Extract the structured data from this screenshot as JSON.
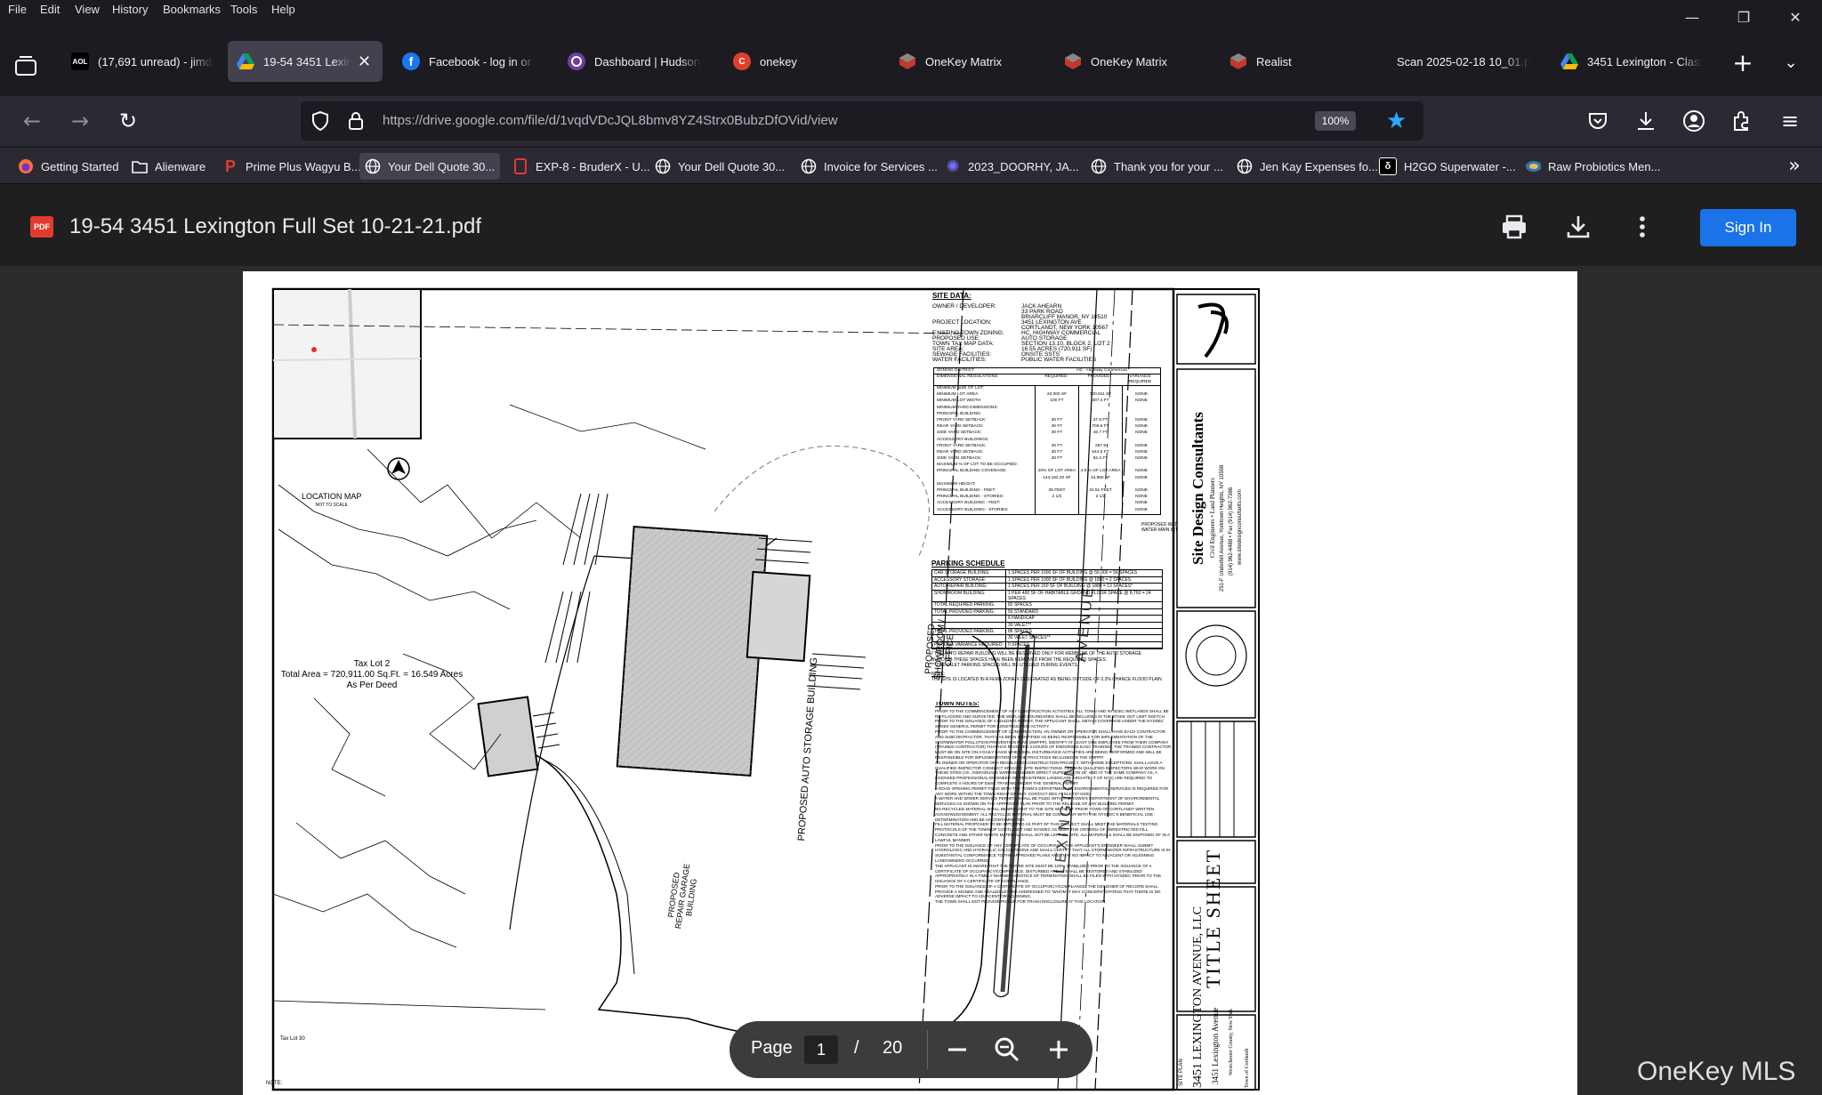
{
  "menu": [
    "File",
    "Edit",
    "View",
    "History",
    "Bookmarks",
    "Tools",
    "Help"
  ],
  "tabs": [
    {
      "title": "(17,691 unread) - jimdi",
      "icon": "aol-icon",
      "active": false
    },
    {
      "title": "19-54 3451 Lexington",
      "icon": "google-drive-icon",
      "active": true
    },
    {
      "title": "Facebook - log in or sig",
      "icon": "facebook-icon",
      "active": false
    },
    {
      "title": "Dashboard | Hudson G",
      "icon": "dashboard-icon",
      "active": false
    },
    {
      "title": "onekey",
      "icon": "onekey-icon",
      "active": false
    },
    {
      "title": "OneKey Matrix",
      "icon": "matrix-icon",
      "active": false
    },
    {
      "title": "OneKey Matrix",
      "icon": "matrix-icon",
      "active": false
    },
    {
      "title": "Realist",
      "icon": "realist-icon",
      "active": false
    },
    {
      "title": "Scan 2025-02-18 10_01.pdf",
      "icon": "",
      "active": false
    },
    {
      "title": "3451 Lexington - Classi",
      "icon": "google-drive-icon",
      "active": false
    }
  ],
  "url": "https://drive.google.com/file/d/1vqdVDcJQL8bmv8YZ4Strx0BubzDfOVid/view",
  "zoom": "100%",
  "bookmarks": [
    {
      "label": "Getting Started",
      "icon": "firefox-icon"
    },
    {
      "label": "Alienware",
      "icon": "folder-icon"
    },
    {
      "label": "Prime Plus Wagyu B...",
      "icon": "prime-icon"
    },
    {
      "label": "Your Dell Quote 30...",
      "icon": "globe-icon"
    },
    {
      "label": "EXP-8 - BruderX - U...",
      "icon": "exp-icon"
    },
    {
      "label": "Your Dell Quote 30...",
      "icon": "globe-icon"
    },
    {
      "label": "Invoice for Services ...",
      "icon": "globe-icon"
    },
    {
      "label": "2023_DOORHY, JA...",
      "icon": "gear-icon"
    },
    {
      "label": "Thank you for your ...",
      "icon": "globe-icon"
    },
    {
      "label": "Jen Kay Expenses fo...",
      "icon": "globe-icon"
    },
    {
      "label": "H2GO Superwater -...",
      "icon": "h2go-icon"
    },
    {
      "label": "Raw Probiotics Men...",
      "icon": "raw-icon"
    }
  ],
  "document": {
    "title": "19-54 3451 Lexington Full Set 10-21-21.pdf",
    "sign_in": "Sign In",
    "pdf_badge": "PDF"
  },
  "pager": {
    "label": "Page",
    "current": "1",
    "separator": "/",
    "total": "20"
  },
  "watermark": "OneKey MLS",
  "colors": {
    "accent": "#1a73e8",
    "tab_active": "#42414d",
    "toolbar": "#2b2a33",
    "pdf_red": "#e23a2e"
  },
  "plan": {
    "location_map_title": "LOCATION MAP",
    "location_map_sub": "NOT TO SCALE",
    "tax_lot_2": "Tax Lot 2",
    "total_area": "Total Area = 720,911.00 Sq.Ft. = 16.549 Acres",
    "as_per_deed": "As Per Deed",
    "storage_bldg": "PROPOSED AUTO STORAGE BUILDING",
    "showroom": "PROPOSED SHOWROOM / OFFICE",
    "repair_garage": "PROPOSED REPAIR GARAGE BUILDING",
    "lexington": "LEXINGTON",
    "avenue": "AVENUE",
    "water_main": "PROPOSED WAT WATER MAIN INT",
    "tax_lot_30": "Tax Lot 30",
    "note_label": "NOTE:",
    "site_data_heading": "SITE DATA:",
    "site_data_rows": [
      [
        "OWNER / DEVELOPER:",
        "JACK AHEARN"
      ],
      [
        "",
        "33 PARK ROAD"
      ],
      [
        "",
        "BRIARCLIFF MANOR, NY 10510"
      ],
      [
        "PROJECT LOCATION:",
        "3451 LEXINGTON AVE"
      ],
      [
        "",
        "CORTLANDT, NEW YORK 10567"
      ],
      [
        "EXISTING TOWN ZONING:",
        "HC, HIGHWAY COMMERCIAL"
      ],
      [
        "PROPOSED USE:",
        "AUTO STORAGE"
      ],
      [
        "TOWN TAX MAP DATA:",
        "SECTION 13.10, BLOCK 2, LOT 2"
      ],
      [
        "SITE AREA:",
        "16.55 ACRES (720,911 SF)"
      ],
      [
        "SEWAGE FACILITIES:",
        "ONSITE SSTS"
      ],
      [
        "WATER FACILITIES:",
        "PUBLIC WATER FACILITIES"
      ]
    ],
    "zoning_district_label": "ZONING DISTRICT",
    "zoning_district_value": "HC - Highway Commercial",
    "zoning_headers": [
      "DIMENSIONAL REGULATIONS:",
      "REQUIRED",
      "PROVIDED",
      "VARIANCE REQUIRED"
    ],
    "zoning_rows": [
      [
        "MINIMUM SIZE OF LOT:",
        "",
        "",
        ""
      ],
      [
        "MINIMUM LOT AREA",
        "20,000 SF",
        "720,911 SF",
        "NONE"
      ],
      [
        "MINIMUM LOT WIDTH",
        "100 FT",
        "407.4 FT",
        "NONE"
      ],
      [
        "MINIMUM YARD DIMENSIONS:",
        "",
        "",
        ""
      ],
      [
        "PRINCIPAL BUILDING:",
        "",
        "",
        ""
      ],
      [
        "FRONT YARD SETBACK:",
        "30 FT",
        "37.5 FT",
        "NONE"
      ],
      [
        "REAR YARD SETBACK:",
        "30 FT",
        "706.6 FT",
        "NONE"
      ],
      [
        "SIDE YARD SETBACK:",
        "30 FT",
        "46.7 FT",
        "NONE"
      ],
      [
        "ACCESSORY BUILDINGS:",
        "",
        "",
        ""
      ],
      [
        "FRONT YARD SETBACK:",
        "30 FT",
        "287.9",
        "NONE"
      ],
      [
        "REAR YARD SETBACK:",
        "30 FT",
        "644.5 FT",
        "NONE"
      ],
      [
        "SIDE YARD SETBACK:",
        "30 FT",
        "82.2 FT",
        "NONE"
      ],
      [
        "MAXIMUM % OF LOT TO BE OCCUPIED:",
        "",
        "",
        ""
      ],
      [
        "PRINCIPAL BUILDING COVERAGE:",
        "20% OF LOT AREA",
        "4.9 % OF LOT AREA",
        "NONE"
      ],
      [
        "",
        "144,182.20 SF",
        "34,880 SF",
        "NONE"
      ],
      [
        "MAXIMUM HEIGHT:",
        "",
        "",
        ""
      ],
      [
        "PRINCIPAL BUILDING - FEET:",
        "35 FEET",
        "34.51 FEET",
        "NONE"
      ],
      [
        "PRINCIPAL BUILDING - STORIES:",
        "2 1/2",
        "2 1/2",
        "NONE"
      ],
      [
        "ACCESSORY BUILDING - FEET:",
        "",
        "",
        "NONE"
      ],
      [
        "ACCESSORY BUILDING - STORIES:",
        "",
        "",
        "NONE"
      ]
    ],
    "parking_heading": "PARKING SCHEDULE",
    "parking_rows": [
      [
        "CAR STORAGE BUILDING:",
        "1 SPACES PER 1000 SF OF BUILDING @ 56,000 = 56 SPACES"
      ],
      [
        "ACCESSORY STORAGE:",
        "1 SPACES PER 1000 SF OF BUILDING @ 1880 = 2 SPACES"
      ],
      [
        "AUTO REPAIR BUILDING:",
        "1 SPACES PER 150 SF OF BUILDING @ 1880 = 13 SPACES*"
      ],
      [
        "SHOWROOM BUILDING:",
        "1 PER 400 SF OF HABITABLE GROUND FLOOR SPACE @ 8,760 = 24 SPACES"
      ],
      [
        "TOTAL REQUIRED PARKING:",
        "82 SPACES"
      ],
      [
        "TOTAL PROVIDED PARKING:",
        "50 STANDARD"
      ],
      [
        "",
        "6 HANDICAP"
      ],
      [
        "",
        "30 VALET**"
      ],
      [
        "TOTAL PROVIDED PARKING:",
        "86 SPACES"
      ],
      [
        "",
        "30 VALET SPACES**"
      ],
      [
        "PARKING VARIANCE REQUIRED:",
        "0 SPACES"
      ]
    ],
    "parking_notes": [
      "* THE AUTO REPAIR BUILDING WILL BE RESERVED ONLY FOR MEMBERS OF THE AUTO STORAGE",
      "BUILDING THESE SPACES HAVE BEEN REMOVED FROM THE REQUIRED SPACES.",
      "** THE VALET PARKING SPACES WILL BE UTILIZED DURING EVENTS."
    ],
    "flood_note": "THE SITE IS LOCATED IN A FEMA ZONE X DESIGNATED AS BEING OUTSIDE OF 0.2% CHANCE FLOOD PLAIN",
    "town_notes_heading": "TOWN NOTES:",
    "town_notes": [
      "PRIOR TO THE COMMENCEMENT OF ANY CONSTRUCTION ACTIVITIES, ALL TOWN AND NYSDEC WETLANDS SHALL BE",
      "RE-FLAGGED AND SURVEYED. THE WETLAND BOUNDARIES SHALL BE INCLUDED IN THE STAKE OUT LIMIT SKETCH.",
      "PRIOR TO THE ISSUANCE OF A BUILDING PERMIT, THE APPLICANT SHALL OBTAIN COVERAGE UNDER THE NYSDEC",
      "SPDES GENERAL PERMIT FOR CONSTRUCTION ACTIVITY.",
      "PRIOR TO THE COMMENCEMENT OF CONSTRUCTION, AN OWNER OR OPERATOR SHALL HAVE EACH CONTRACTOR",
      "AND SUBCONTRACTOR, THAT HAS BEEN IDENTIFIED AS BEING RESPONSIBLE FOR IMPLEMENTATION OF THE",
      "STORMWATER POLLUTION PREVENTION PLAN (SWPPP), IDENTIFY AT LEAST ONE EMPLOYEE FROM THEIR COMPANY",
      "(TRAINED CONTRACTOR) THAT HAS RECEIVED 4 HOURS OF ENDORSED EASC TRAINING. THE TRAINED CONTRACTOR",
      "MUST BE ON SITE ON A DAILY BASIS WHEN SOIL DISTURBANCE ACTIVITIES ARE BEING PERFORMED AND WILL BE",
      "RESPONSIBLE FOR IMPLEMENTATION OF THE PRACTICES INCLUDED IN THE SWPPP.",
      "AN OWNER OR OPERATOR OF A REGULATED CONSTRUCTION PROJECT, WITH SOME EXCEPTIONS, SHALL HAVE A",
      "QUALIFIED INSPECTOR CONDUCT SPECIFIC SITE INSPECTIONS. CERTAIN QUALIFIED INSPECTORS WHO WORK ON",
      "THESE SITES (I.E., INDIVIDUALS WORKING UNDER DIRECT SUPERVISION OF, AND AT THE SAME COMPANY AS, A",
      "LICENSED PROFESSIONAL ENGINEER OR REGISTERED LANDSCAPE ARCHITECT OF NYS) ARE REQUIRED TO",
      "COMPLETE 4 HOURS OF E&SC TRAINING UNDER THE GENERAL PERMIT.",
      "A ROAD OPENING PERMIT FILED WITH THE TOWN'S DEPARTMENT OF ENVIRONMENTAL SERVICES IS REQUIRED FOR",
      "ANY WORK WITHIN THE TOWN RIGHT-OF-WAY. CONTACT DES AT 914-737-0100.",
      "A WATER AND SEWER SERVICE PERMITS SHALL BE FILED WITH THE TOWN'S DEPARTMENT OF ENVIRONMENTAL",
      "SERVICES AS SHOWN ON THE APPROVED PLAN PRIOR TO THE RELEASE OF ANY BUILDING PERMIT.",
      "NO RECYCLED MATERIAL SHALL BE BROUGHT TO THE SITE WITHOUT PRIOR TOWN OF CORTLANDT WRITTEN",
      "ACKNOWLEDGEMENT. ALL RECYCLED MATERIAL MUST BE COMPLIANT WITH THE NYSDEC'S BENEFICIAL USE",
      "DETERMINATION AND BE UNCONTAMINATED.",
      "FILL MATERIAL PROPOSED TO BE IMPORTED AS PART OF THIS PROJECT SHALL MEET THE MATERIALS TESTING",
      "PROTOCOLS OF THE TOWN OF CORTLANDT AND NYSDEC AS MEET THE CRITERIA OF UNRESTRICTED FILL.",
      "CONCRETE AND OTHER WASTE MATERIAL SHALL NOT BE LEFT ON SITE. ALL MATERIALS SHALL BE DISPOSED OF IN A",
      "LAWFUL MANNER.",
      "PRIOR TO THE ISSUANCE OF ANY CERTIFICATE OF OCCUPANCY, THE APPLICANT'S ENGINEER SHALL SUBMIT",
      "HYDROLOGIC AND HYDRAULIC CALCULATIONS AND SHALL CERTIFY THAT ALL STORM WATER INFRASTRUCTURE IS IN",
      "SUBSTANTIAL CONFORMANCE TO THE APPROVED PLANS AND THAT NO IMPACT TO ADJACENT OR ADJOINING",
      "LANDOWNERS OCCURRED.",
      "THE APPLICANT IS AWARE THAT THE ENTIRE SITE MUST BE 100% STABILIZED PRIOR TO THE ISSUANCE OF A",
      "CERTIFICATE OF OCCUPANCY/COMPLIANCE. DISTURBED AREAS SHALL BE RESTORED AND STABILIZED",
      "APPROPRIATELY IN A TIMELY MANNER. A NOTICE OF TERMINATION SHALL BE FILED WITH NYSDEC PRIOR TO THE",
      "ISSUANCE OF A CERTIFICATE OF COMPLIANCE.",
      "PRIOR TO THE ISSUANCE OF A CERTIFICATE OF OCCUPANCY/COMPLIANCE, THE DESIGNER OF RECORD SHALL",
      "PROVIDE A SIGNED AND SEALED LETTER ADDRESSED TO \"WHOM IT MAY CONCERN\" STATING THAT THERE IS NO",
      "ADVERSE IMPACT TO ADJACENT OR ADJOINING.",
      "THE TOWN SHALL NOT PROVIDE PICKUP FOR TRASH ENCLOSURE AT THIS LOCATION."
    ],
    "firm_name": "Site Design Consultants",
    "firm_sub1": "Civil Engineers • Land Planners",
    "firm_sub2": "251-F Underhill Avenue, Yorktown Heights, NY 10598",
    "firm_sub3": "(914) 962-4488 • Fax (914) 962-7386",
    "firm_sub4": "www.sitedesignconsultants.com",
    "sheet_title": "TITLE SHEET",
    "project_name": "3451 LEXINGTON AVENUE, LLC",
    "project_sub": "3451 Lexington Avenue",
    "project_loc": "Westchester County, New York",
    "site_plan_label": "SITE PLAN",
    "town_label": "Town of Cortlandt"
  }
}
